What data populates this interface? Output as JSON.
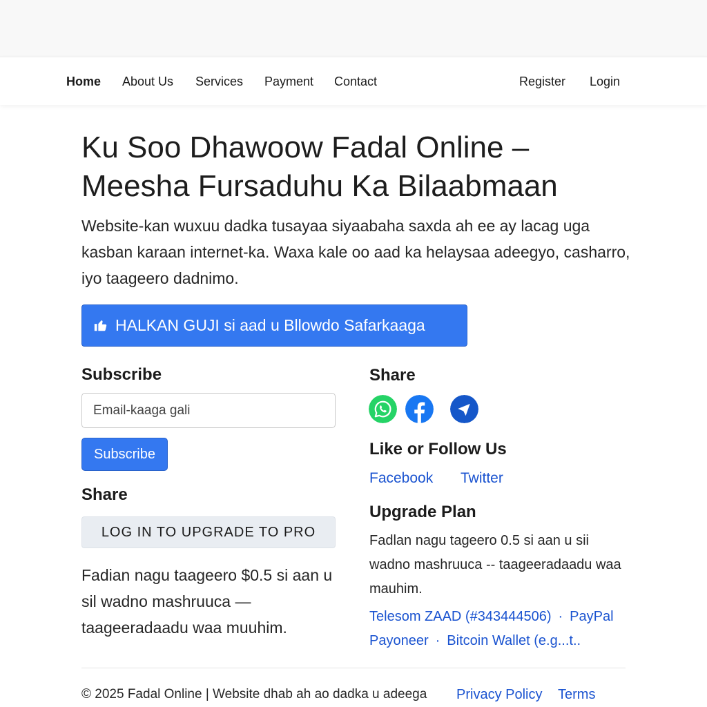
{
  "nav": {
    "home": "Home",
    "about": "About Us",
    "services": "Services",
    "payment": "Payment",
    "contact": "Contact",
    "register": "Register",
    "login": "Login"
  },
  "hero": {
    "title_line1": "Ku Soo Dhawoow Fadal Online –",
    "title_line2": "Meesha Fursaduhu Ka Bilaabmaan",
    "text": "Website-kan wuxuu dadka tusayaa siyaabaha saxda ah ee ay lacag uga kasban karaan internet-ka. Waxa kale oo aad ka helaysaa adeegyo, casharro, iyo taageero dadnimo.",
    "cta_label": "HALKAN GUJI si aad u Bllowdo Safarkaaga",
    "cta_icon": "thumbs-up-icon"
  },
  "subscribe": {
    "heading": "Subscribe",
    "placeholder": "Email-kaaga gali",
    "button": "Subscribe"
  },
  "left_share": {
    "heading": "Share",
    "upgrade_button": "LOG IN TO UPGRADE TO PRO",
    "support_text": "Fadian nagu taageero $0.5 si aan u sil wadno mashruuca — taageeradaadu waa muuhim."
  },
  "right_share": {
    "heading": "Share",
    "icons": [
      "whatsapp-icon",
      "facebook-icon",
      "telegram-icon"
    ],
    "colors": {
      "whatsapp": "#25d366",
      "facebook": "#1877f2",
      "telegram": "#1557c9"
    }
  },
  "follow": {
    "heading": "Like or Follow Us",
    "facebook": "Facebook",
    "twitter": "Twitter"
  },
  "upgrade_plan": {
    "heading": "Upgrade Plan",
    "text": "Fadlan nagu tageero 0.5 si aan u sii wadno mashruuca -- taageeradaadu waa mauhim.",
    "telesom": "Telesom ZAAD",
    "telesom_number": "#343444506",
    "paypal": "PayPal",
    "payoneer": "Payoneer",
    "bitcoin": "Bitcoin Wallet (e.g...t.."
  },
  "footer": {
    "copyright": "© 2025 Fadal Online | Website dhab ah ao dadka u adeega",
    "privacy": "Privacy Policy",
    "terms": "Terms"
  },
  "colors": {
    "primary": "#3478f0",
    "link": "#1a53d0",
    "upgrade_bg": "#e9edf2"
  }
}
